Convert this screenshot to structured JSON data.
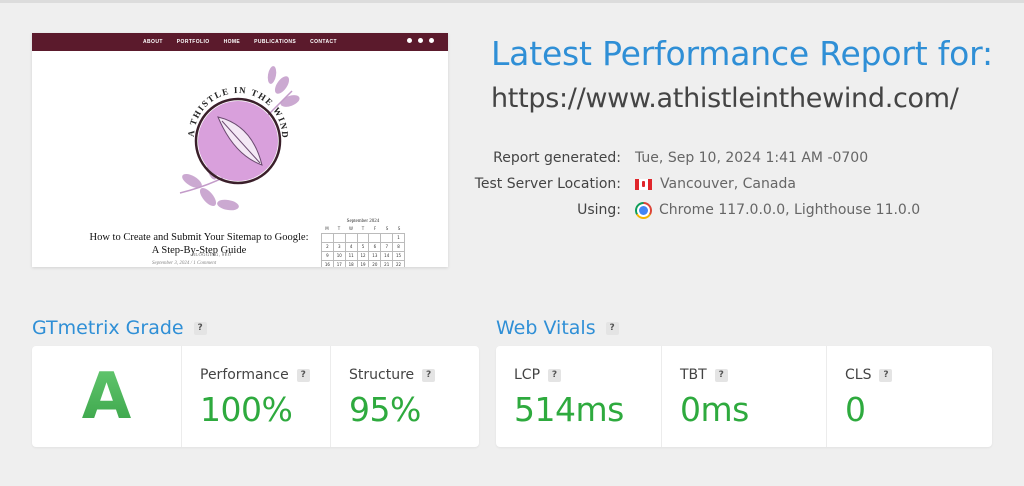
{
  "thumbnail": {
    "nav_items": [
      "ABOUT",
      "PORTFOLIO",
      "HOME",
      "PUBLICATIONS",
      "CONTACT"
    ],
    "logo_text": "A THISTLE IN THE WIND",
    "post_category": "BLOGGING, SEO",
    "post_title": "How to Create and Submit Your Sitemap to Google: A Step-By-Step Guide",
    "post_meta": "September 3, 2024 / 1 Comment",
    "calendar_title": "September 2024",
    "calendar_days": [
      "M",
      "T",
      "W",
      "T",
      "F",
      "S",
      "S"
    ],
    "calendar_cells": [
      "",
      "",
      "",
      "",
      "",
      "",
      "1",
      "2",
      "3",
      "4",
      "5",
      "6",
      "7",
      "8",
      "9",
      "10",
      "11",
      "12",
      "13",
      "14",
      "15",
      "16",
      "17",
      "18",
      "19",
      "20",
      "21",
      "22"
    ]
  },
  "report": {
    "title": "Latest Performance Report for:",
    "url": "https://www.athistleinthewind.com/",
    "generated_label": "Report generated:",
    "generated_value": "Tue, Sep 10, 2024 1:41 AM -0700",
    "location_label": "Test Server Location:",
    "location_value": "Vancouver, Canada",
    "using_label": "Using:",
    "using_value": "Chrome 117.0.0.0, Lighthouse 11.0.0"
  },
  "grade_section": {
    "title": "GTmetrix Grade",
    "help": "?",
    "grade": "A",
    "performance_label": "Performance",
    "performance_value": "100%",
    "structure_label": "Structure",
    "structure_value": "95%"
  },
  "vitals_section": {
    "title": "Web Vitals",
    "help": "?",
    "lcp_label": "LCP",
    "lcp_value": "514ms",
    "tbt_label": "TBT",
    "tbt_value": "0ms",
    "cls_label": "CLS",
    "cls_value": "0"
  },
  "colors": {
    "accent_blue": "#2f8fd6",
    "good_green": "#2eaa3e",
    "thumb_nav": "#5b1a2c",
    "logo_purple": "#d9a0dc"
  },
  "icons": {
    "flag": "canada-flag-icon",
    "browser": "chrome-icon",
    "help": "question-badge-icon"
  }
}
